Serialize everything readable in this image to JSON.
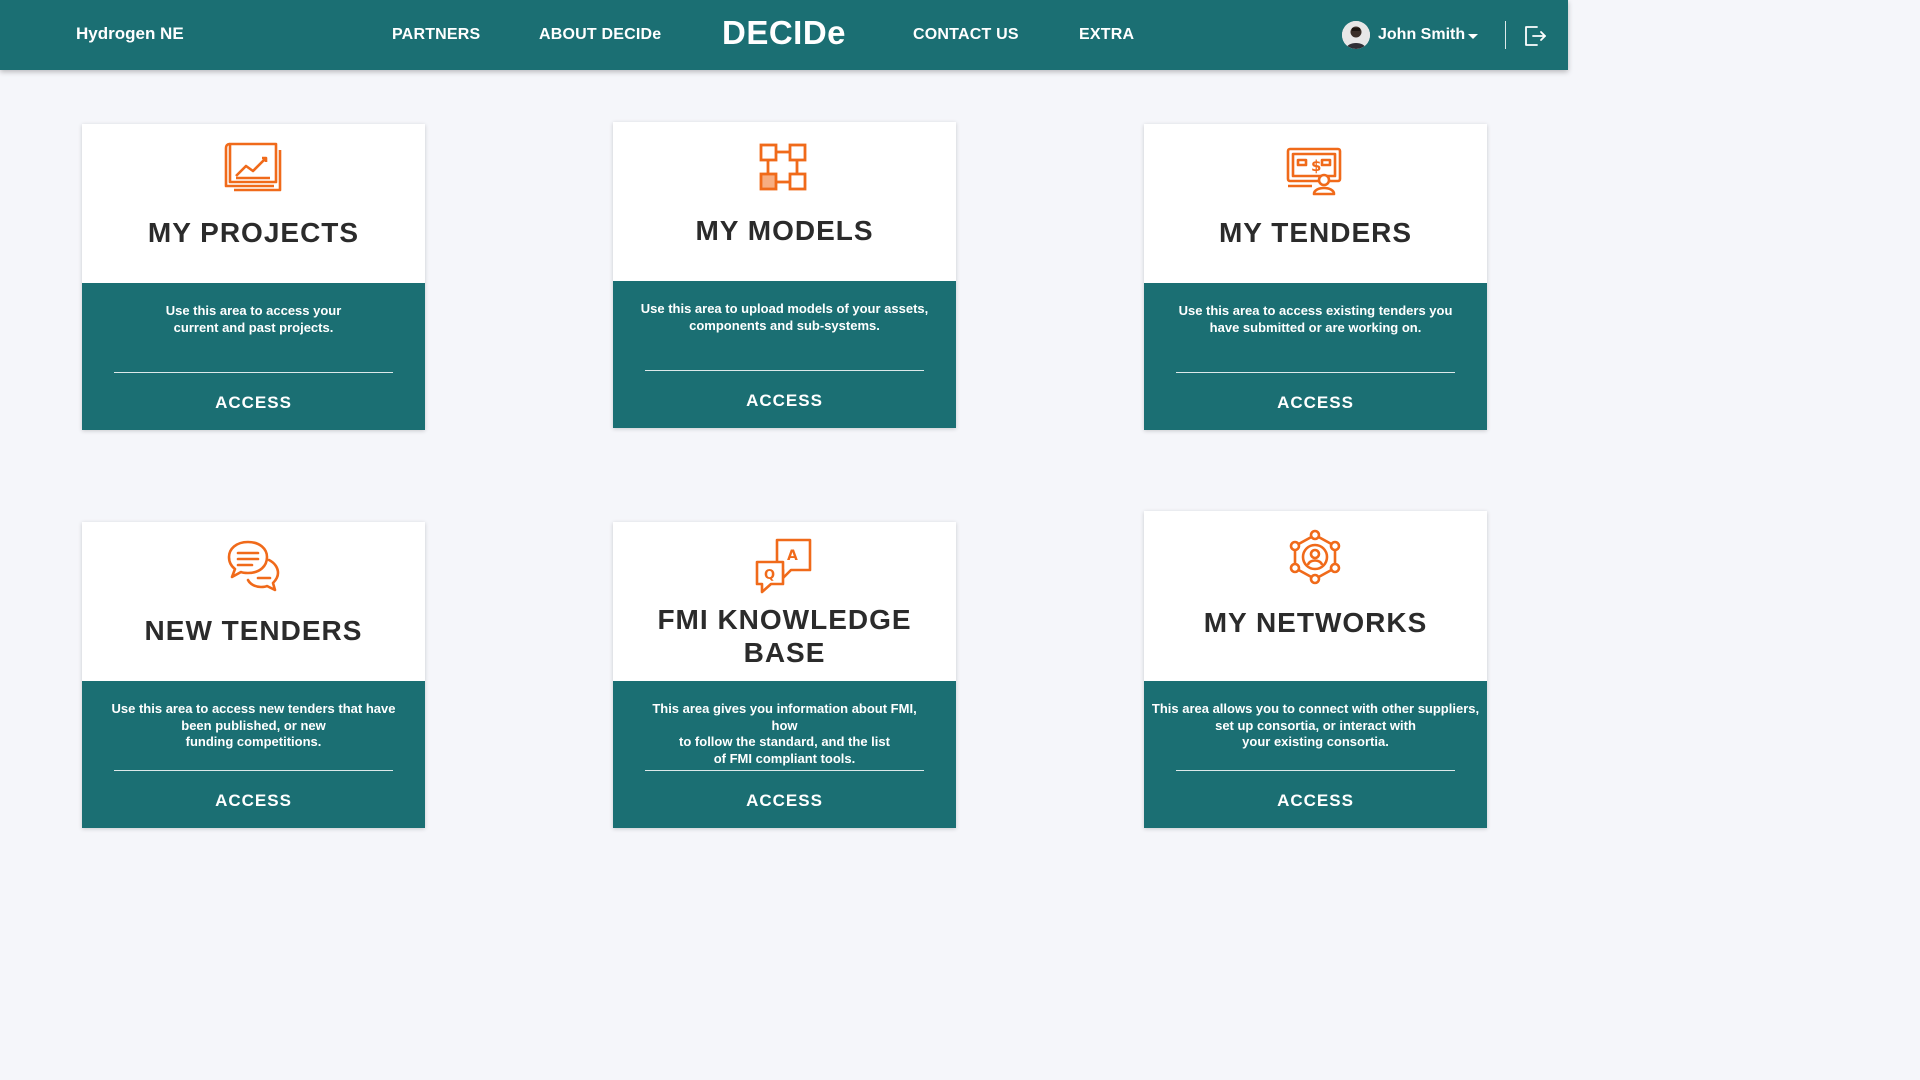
{
  "navbar": {
    "brand": "Hydrogen NE",
    "links": [
      "PARTNERS",
      "ABOUT DECIDe",
      "CONTACT US",
      "EXTRA"
    ],
    "logo": "DECIDe",
    "user_name": "John Smith",
    "colors": {
      "bar": "#1b6f73",
      "text": "#ffffff"
    }
  },
  "accent_color": "#f06a1a",
  "cards": [
    {
      "icon": "projects-icon",
      "title": "MY PROJECTS",
      "desc": [
        "Use this area to access your",
        "current and past projects."
      ],
      "action": "ACCESS"
    },
    {
      "icon": "models-icon",
      "title": "MY MODELS",
      "desc": [
        "Use this area to upload models of your assets,",
        "components and sub-systems."
      ],
      "action": "ACCESS"
    },
    {
      "icon": "tenders-icon",
      "title": "MY TENDERS",
      "desc": [
        "Use this area to access existing tenders you",
        "have submitted or are working on."
      ],
      "action": "ACCESS"
    },
    {
      "icon": "chat-icon",
      "title": "NEW TENDERS",
      "desc": [
        "Use this area to access new tenders that have",
        "been published, or new",
        "funding competitions."
      ],
      "action": "ACCESS"
    },
    {
      "icon": "qa-icon",
      "title": [
        "FMI KNOWLEDGE",
        "BASE"
      ],
      "desc": [
        "This area gives you information about FMI, how",
        "to follow the standard, and the list",
        "of FMI compliant tools."
      ],
      "action": "ACCESS"
    },
    {
      "icon": "network-icon",
      "title": "MY NETWORKS",
      "desc": [
        "This area allows you to connect with other suppliers,",
        "set up consortia, or interact with",
        "your existing consortia."
      ],
      "action": "ACCESS"
    }
  ]
}
